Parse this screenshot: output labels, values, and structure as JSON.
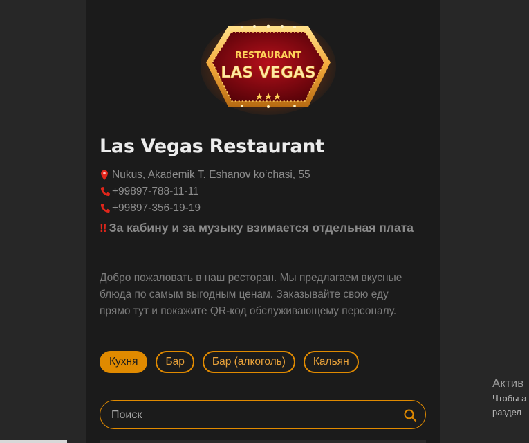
{
  "restaurant": {
    "logo_top_text": "RESTAURANT",
    "logo_main_text": "LAS VEGAS",
    "name": "Las Vegas Restaurant",
    "address": "Nukus, Akademik T. Eshanov ko‘chasi, 55",
    "phones": [
      "+99897-788-11-11",
      "+99897-356-19-19"
    ],
    "warning_mark": "‼",
    "warning": "За кабину и за музыку взимается отдельная плата",
    "description": "Добро пожаловать в наш ресторан. Мы предлагаем вкусные блюда по самым выгодным ценам. Заказывайте свою еду прямо тут и покажите QR-код обслуживающему персоналу."
  },
  "categories": [
    {
      "label": "Кухня",
      "active": true
    },
    {
      "label": "Бар",
      "active": false
    },
    {
      "label": "Бар (алкоголь)",
      "active": false
    },
    {
      "label": "Кальян",
      "active": false
    }
  ],
  "search": {
    "placeholder": "Поиск",
    "value": ""
  },
  "windows_activation": {
    "title": "Актив",
    "line1": "Чтобы а",
    "line2": "раздел"
  },
  "icons": {
    "address": "map-pin-icon",
    "phone": "phone-icon",
    "warning": "double-exclamation-icon",
    "search": "search-icon"
  },
  "colors": {
    "accent": "#e08a00",
    "panel_bg": "#1b1b1b",
    "page_bg": "#272727",
    "icon_red": "#e0261b"
  }
}
